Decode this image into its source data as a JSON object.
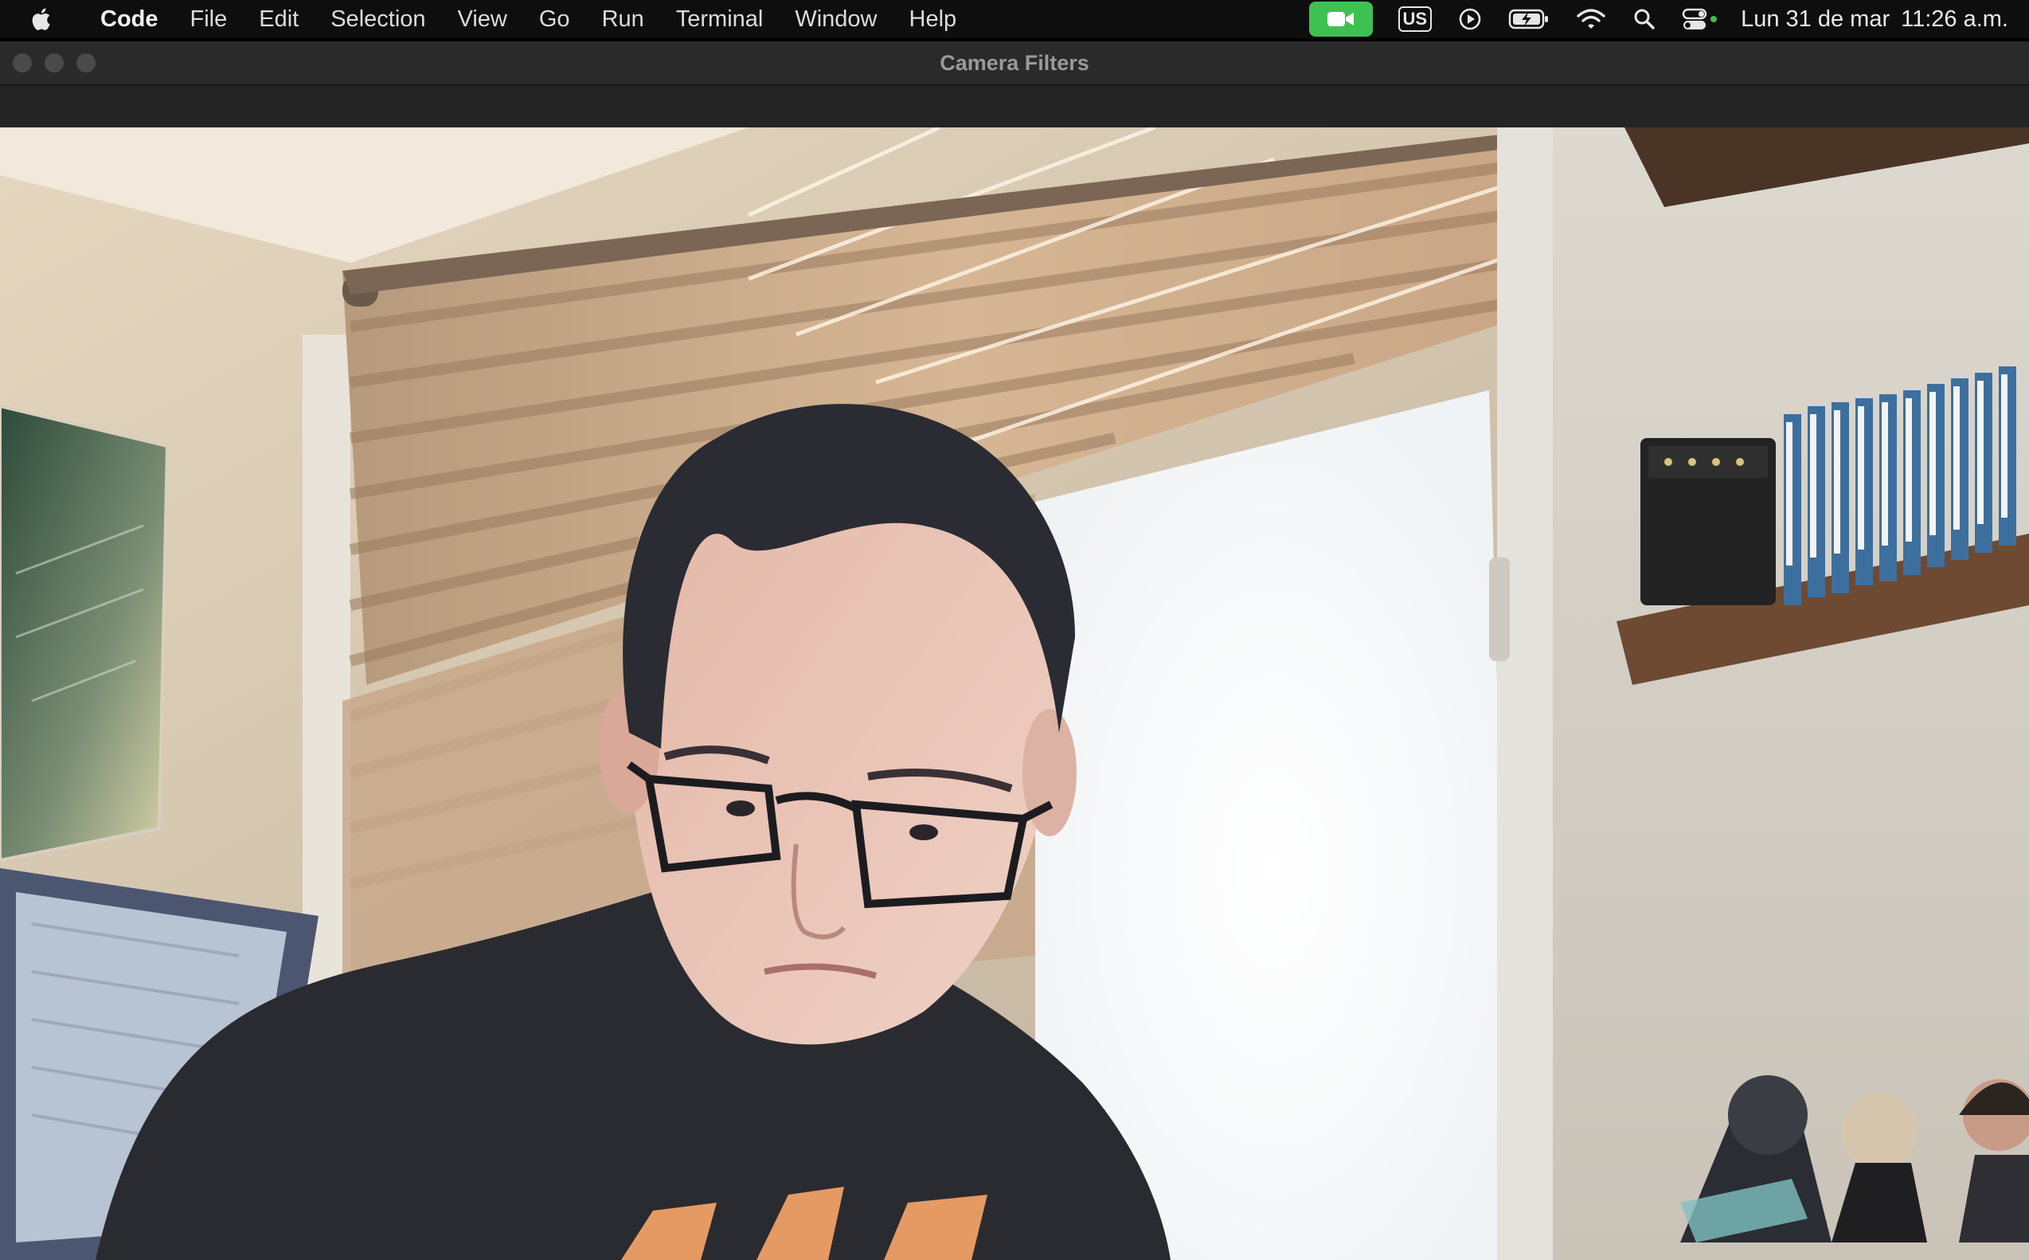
{
  "menubar": {
    "apple_icon": "apple-icon",
    "app_name": "Code",
    "menus": [
      "File",
      "Edit",
      "Selection",
      "View",
      "Go",
      "Run",
      "Terminal",
      "Window",
      "Help"
    ],
    "status_icons": [
      "camera-in-use-icon",
      "keyboard-layout-icon",
      "play-circle-icon",
      "battery-charging-icon",
      "wifi-icon",
      "spotlight-search-icon",
      "control-center-icon"
    ],
    "keyboard_layout": "US",
    "date": "Lun 31 de mar",
    "time": "11:26 a.m."
  },
  "window": {
    "title": "Camera Filters"
  },
  "colors": {
    "camera_indicator": "#3fc152",
    "menubar_bg": "#0e0e0e",
    "titlebar_bg": "#2a2a2a"
  }
}
